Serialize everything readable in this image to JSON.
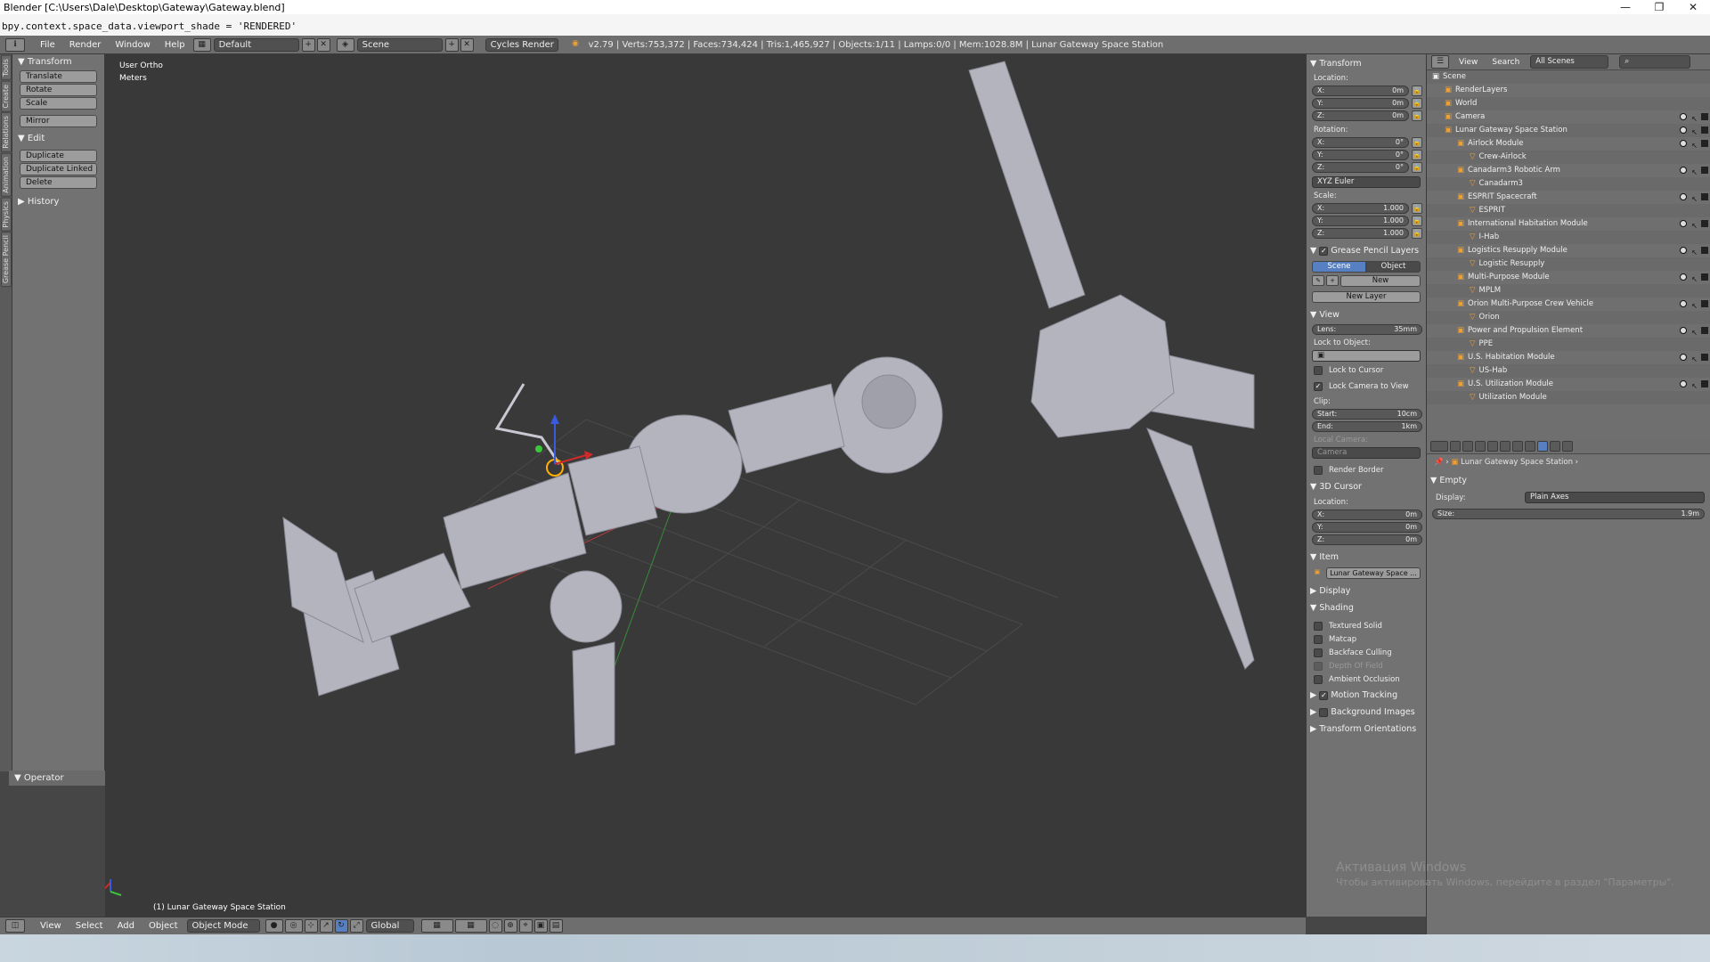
{
  "window": {
    "title": "Blender [C:\\Users\\Dale\\Desktop\\Gateway\\Gateway.blend]",
    "min": "—",
    "max": "❐",
    "close": "✕"
  },
  "info_line": "bpy.context.space_data.viewport_shade = 'RENDERED'",
  "header": {
    "menus": [
      "File",
      "Render",
      "Window",
      "Help"
    ],
    "layout": "Default",
    "scene": "Scene",
    "engine": "Cycles Render",
    "stats": "v2.79 | Verts:753,372 | Faces:734,424 | Tris:1,465,927 | Objects:1/11 | Lamps:0/0 | Mem:1028.8M | Lunar Gateway Space Station"
  },
  "vtabs": [
    "Tools",
    "Create",
    "Relations",
    "Animation",
    "Physics",
    "Grease Pencil"
  ],
  "toolshelf": {
    "transform_title": "Transform",
    "transform": [
      "Translate",
      "Rotate",
      "Scale"
    ],
    "mirror": "Mirror",
    "edit_title": "Edit",
    "edit": [
      "Duplicate",
      "Duplicate Linked",
      "Delete"
    ],
    "history": "History",
    "operator": "Operator"
  },
  "viewport": {
    "view_name": "User Ortho",
    "units": "Meters",
    "object_label": "(1) Lunar Gateway Space Station"
  },
  "npanel": {
    "transform": "Transform",
    "location": "Location:",
    "rotation": "Rotation:",
    "scale": "Scale:",
    "loc": [
      {
        "a": "X:",
        "v": "0m"
      },
      {
        "a": "Y:",
        "v": "0m"
      },
      {
        "a": "Z:",
        "v": "0m"
      }
    ],
    "rot": [
      {
        "a": "X:",
        "v": "0°"
      },
      {
        "a": "Y:",
        "v": "0°"
      },
      {
        "a": "Z:",
        "v": "0°"
      }
    ],
    "rot_mode": "XYZ Euler",
    "scl": [
      {
        "a": "X:",
        "v": "1.000"
      },
      {
        "a": "Y:",
        "v": "1.000"
      },
      {
        "a": "Z:",
        "v": "1.000"
      }
    ],
    "gp_layers": "Grease Pencil Layers",
    "gp_scene": "Scene",
    "gp_object": "Object",
    "gp_new": "New",
    "gp_new_layer": "New Layer",
    "view": "View",
    "lens_label": "Lens:",
    "lens": "35mm",
    "lock_obj": "Lock to Object:",
    "lock_cursor": "Lock to Cursor",
    "lock_camera": "Lock Camera to View",
    "clip": "Clip:",
    "start_label": "Start:",
    "start": "10cm",
    "end_label": "End:",
    "end": "1km",
    "local_camera": "Local Camera:",
    "camera": "Camera",
    "render_border": "Render Border",
    "cursor": "3D Cursor",
    "cur_loc": "Location:",
    "cur": [
      {
        "a": "X:",
        "v": "0m"
      },
      {
        "a": "Y:",
        "v": "0m"
      },
      {
        "a": "Z:",
        "v": "0m"
      }
    ],
    "item": "Item",
    "item_name": "Lunar Gateway Space ...",
    "display": "Display",
    "shading": "Shading",
    "shading_opts": [
      "Textured Solid",
      "Matcap",
      "Backface Culling",
      "Depth Of Field",
      "Ambient Occlusion"
    ],
    "motion": "Motion Tracking",
    "bg": "Background Images",
    "orient": "Transform Orientations"
  },
  "outliner": {
    "view": "View",
    "search": "Search",
    "filter": "All Scenes",
    "rows": [
      {
        "t": "Scene",
        "i": 0
      },
      {
        "t": "RenderLayers",
        "i": 1
      },
      {
        "t": "World",
        "i": 1
      },
      {
        "t": "Camera",
        "i": 1
      },
      {
        "t": "Lunar Gateway Space Station",
        "i": 1
      },
      {
        "t": "Airlock Module",
        "i": 2
      },
      {
        "t": "Crew-Airlock",
        "i": 3
      },
      {
        "t": "Canadarm3 Robotic Arm",
        "i": 2
      },
      {
        "t": "Canadarm3",
        "i": 3
      },
      {
        "t": "ESPRIT Spacecraft",
        "i": 2
      },
      {
        "t": "ESPRIT",
        "i": 3
      },
      {
        "t": "International Habitation Module",
        "i": 2
      },
      {
        "t": "I-Hab",
        "i": 3
      },
      {
        "t": "Logistics Resupply Module",
        "i": 2
      },
      {
        "t": "Logistic Resupply",
        "i": 3
      },
      {
        "t": "Multi-Purpose Module",
        "i": 2
      },
      {
        "t": "MPLM",
        "i": 3
      },
      {
        "t": "Orion Multi-Purpose Crew Vehicle",
        "i": 2
      },
      {
        "t": "Orion",
        "i": 3
      },
      {
        "t": "Power and Propulsion Element",
        "i": 2
      },
      {
        "t": "PPE",
        "i": 3
      },
      {
        "t": "U.S. Habitation Module",
        "i": 2
      },
      {
        "t": "US-Hab",
        "i": 3
      },
      {
        "t": "U.S. Utilization Module",
        "i": 2
      },
      {
        "t": "Utilization Module",
        "i": 3
      }
    ]
  },
  "props": {
    "breadcrumb": "Lunar Gateway Space Station",
    "empty": "Empty",
    "display_label": "Display:",
    "display": "Plain Axes",
    "size_label": "Size:",
    "size": "1.9m"
  },
  "bottombar": {
    "menus": [
      "View",
      "Select",
      "Add",
      "Object"
    ],
    "mode": "Object Mode",
    "orientation": "Global"
  },
  "watermark": {
    "line1": "Активация Windows",
    "line2": "Чтобы активировать Windows, перейдите в раздел \"Параметры\"."
  },
  "colors": {
    "accent": "#5680c2",
    "panel": "#727272",
    "viewport": "#393939"
  }
}
